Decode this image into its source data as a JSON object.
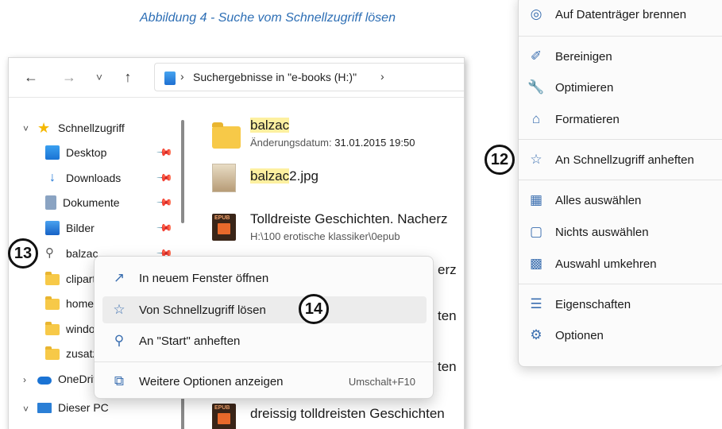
{
  "caption": "Abbildung 4 - Suche vom Schnellzugriff lösen",
  "explorer": {
    "nav": {
      "back": "←",
      "forward": "→",
      "recent": "˅",
      "up": "↑"
    },
    "address": {
      "separator": "›",
      "text": "Suchergebnisse in \"e-books (H:)\"",
      "trailing": "›"
    },
    "sidebar": {
      "quick_access": "Schnellzugriff",
      "items": [
        "Desktop",
        "Downloads",
        "Dokumente",
        "Bilder",
        "balzac",
        "clipart",
        "home",
        "windo",
        "zusatz"
      ],
      "onedrive": "OneDrive",
      "this_pc": "Dieser PC"
    },
    "results": [
      {
        "highlight": "balzac",
        "rest": "",
        "sub_label": "Änderungsdatum:",
        "sub_value": "31.01.2015 19:50"
      },
      {
        "highlight": "balzac",
        "rest": "2.jpg"
      },
      {
        "name": "Tolldreiste Geschichten. Nacherz",
        "sub": "H:\\100 erotische klassiker\\0epub"
      },
      {
        "name_partial": "erz"
      },
      {
        "name_partial": "ten"
      },
      {
        "name_partial": "ten"
      },
      {
        "name": "dreissig tolldreisten Geschichten"
      }
    ],
    "epub_label": "EPUB"
  },
  "context_menu": {
    "items": [
      {
        "icon": "open-new-window-icon",
        "glyph": "↗",
        "label": "In neuem Fenster öffnen"
      },
      {
        "icon": "unpin-star-icon",
        "glyph": "☆",
        "label": "Von Schnellzugriff lösen"
      },
      {
        "icon": "pin-icon",
        "glyph": "⚲",
        "label": "An \"Start\" anheften"
      },
      {
        "icon": "more-options-icon",
        "glyph": "⧉",
        "label": "Weitere Optionen anzeigen",
        "shortcut": "Umschalt+F10"
      }
    ]
  },
  "right_menu": {
    "items": [
      {
        "icon": "burn-disc-icon",
        "glyph": "◎",
        "label": "Auf Datenträger brennen"
      },
      {
        "icon": "broom-icon",
        "glyph": "✐",
        "label": "Bereinigen"
      },
      {
        "icon": "wrench-icon",
        "glyph": "🔧",
        "label": "Optimieren"
      },
      {
        "icon": "format-icon",
        "glyph": "⌂",
        "label": "Formatieren"
      },
      {
        "icon": "star-pin-icon",
        "glyph": "☆",
        "label": "An Schnellzugriff anheften"
      },
      {
        "icon": "select-all-icon",
        "glyph": "▦",
        "label": "Alles auswählen"
      },
      {
        "icon": "select-none-icon",
        "glyph": "▢",
        "label": "Nichts auswählen"
      },
      {
        "icon": "invert-selection-icon",
        "glyph": "▩",
        "label": "Auswahl umkehren"
      },
      {
        "icon": "properties-icon",
        "glyph": "☰",
        "label": "Eigenschaften"
      },
      {
        "icon": "options-icon",
        "glyph": "⚙",
        "label": "Optionen"
      }
    ]
  },
  "badges": {
    "b12": "12",
    "b13": "13",
    "b14": "14"
  },
  "colors": {
    "caption": "#2e6fb5",
    "highlight": "#fdf0a0",
    "accent": "#3b6fb0",
    "folder": "#f7c948"
  }
}
